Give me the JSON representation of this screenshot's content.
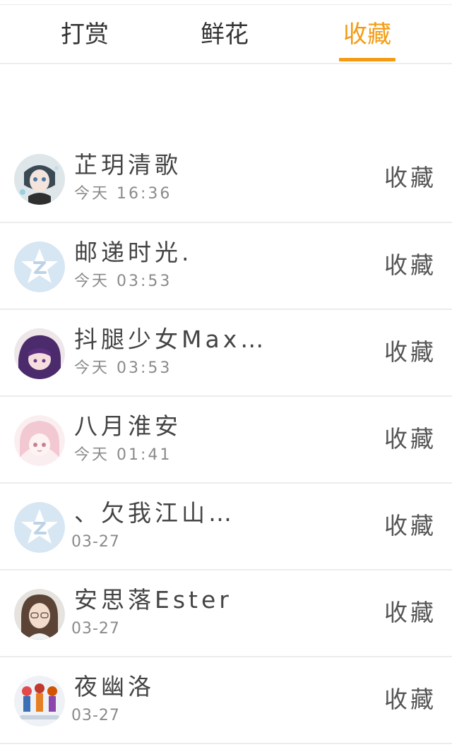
{
  "tabs": {
    "items": [
      {
        "label": "打赏"
      },
      {
        "label": "鲜花"
      },
      {
        "label": "收藏"
      }
    ],
    "active_index": 2,
    "active_color": "#f39c12"
  },
  "list": {
    "items": [
      {
        "name": "芷玥清歌",
        "time": "今天 16:36",
        "action": "收藏",
        "avatar": "anime-girl-avatar"
      },
      {
        "name": "邮递时光.",
        "time": "今天 03:53",
        "action": "收藏",
        "avatar": "default-qq-avatar"
      },
      {
        "name": "抖腿少女Max…",
        "time": "今天 03:53",
        "action": "收藏",
        "avatar": "purple-hair-avatar"
      },
      {
        "name": "八月淮安",
        "time": "今天 01:41",
        "action": "收藏",
        "avatar": "pink-anime-avatar"
      },
      {
        "name": "、欠我江山…",
        "time": "03-27",
        "action": "收藏",
        "avatar": "default-qq-avatar"
      },
      {
        "name": "安思落Ester",
        "time": "03-27",
        "action": "收藏",
        "avatar": "girl-photo-avatar"
      },
      {
        "name": "夜幽洛",
        "time": "03-27",
        "action": "收藏",
        "avatar": "group-anime-avatar"
      }
    ]
  }
}
